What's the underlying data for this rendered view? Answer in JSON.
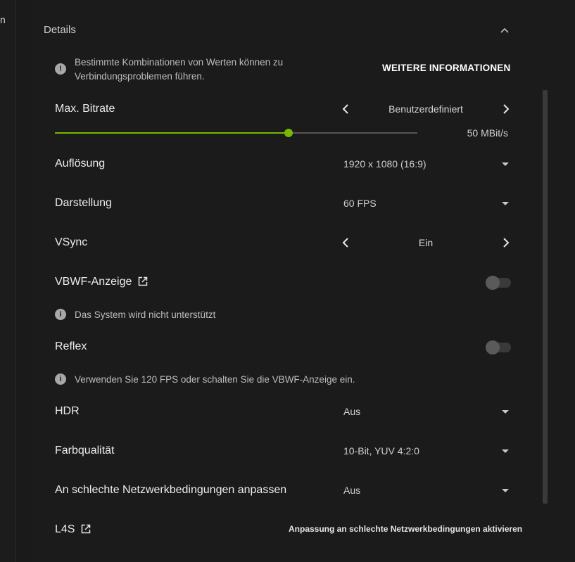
{
  "left_strip": {
    "clipped_char": "n"
  },
  "details": {
    "title": "Details",
    "notice": {
      "line1": "Bestimmte Kombinationen von Werten können zu",
      "line2": "Verbindungsproblemen führen."
    },
    "more_info_label": "WEITERE INFORMATIONEN"
  },
  "settings": {
    "bitrate": {
      "label": "Max. Bitrate",
      "mode": "Benutzerdefiniert",
      "value_text": "50 MBit/s",
      "slider_fraction": 0.645
    },
    "resolution": {
      "label": "Auflösung",
      "value": "1920 x 1080 (16:9)"
    },
    "display": {
      "label": "Darstellung",
      "value": "60 FPS"
    },
    "vsync": {
      "label": "VSync",
      "value": "Ein"
    },
    "vbwf": {
      "label": "VBWF-Anzeige",
      "enabled": false,
      "info": "Das System wird nicht unterstützt"
    },
    "reflex": {
      "label": "Reflex",
      "enabled": false,
      "info": "Verwenden Sie 120 FPS oder schalten Sie die VBWF-Anzeige ein."
    },
    "hdr": {
      "label": "HDR",
      "value": "Aus"
    },
    "color_quality": {
      "label": "Farbqualität",
      "value": "10-Bit, YUV 4:2:0"
    },
    "bad_network": {
      "label": "An schlechte Netzwerkbedingungen anpassen",
      "value": "Aus"
    },
    "l4s": {
      "label": "L4S",
      "hint": "Anpassung an schlechte Netzwerkbedingungen aktivieren"
    }
  },
  "colors": {
    "accent": "#76b900",
    "background": "#1b1b1b"
  }
}
